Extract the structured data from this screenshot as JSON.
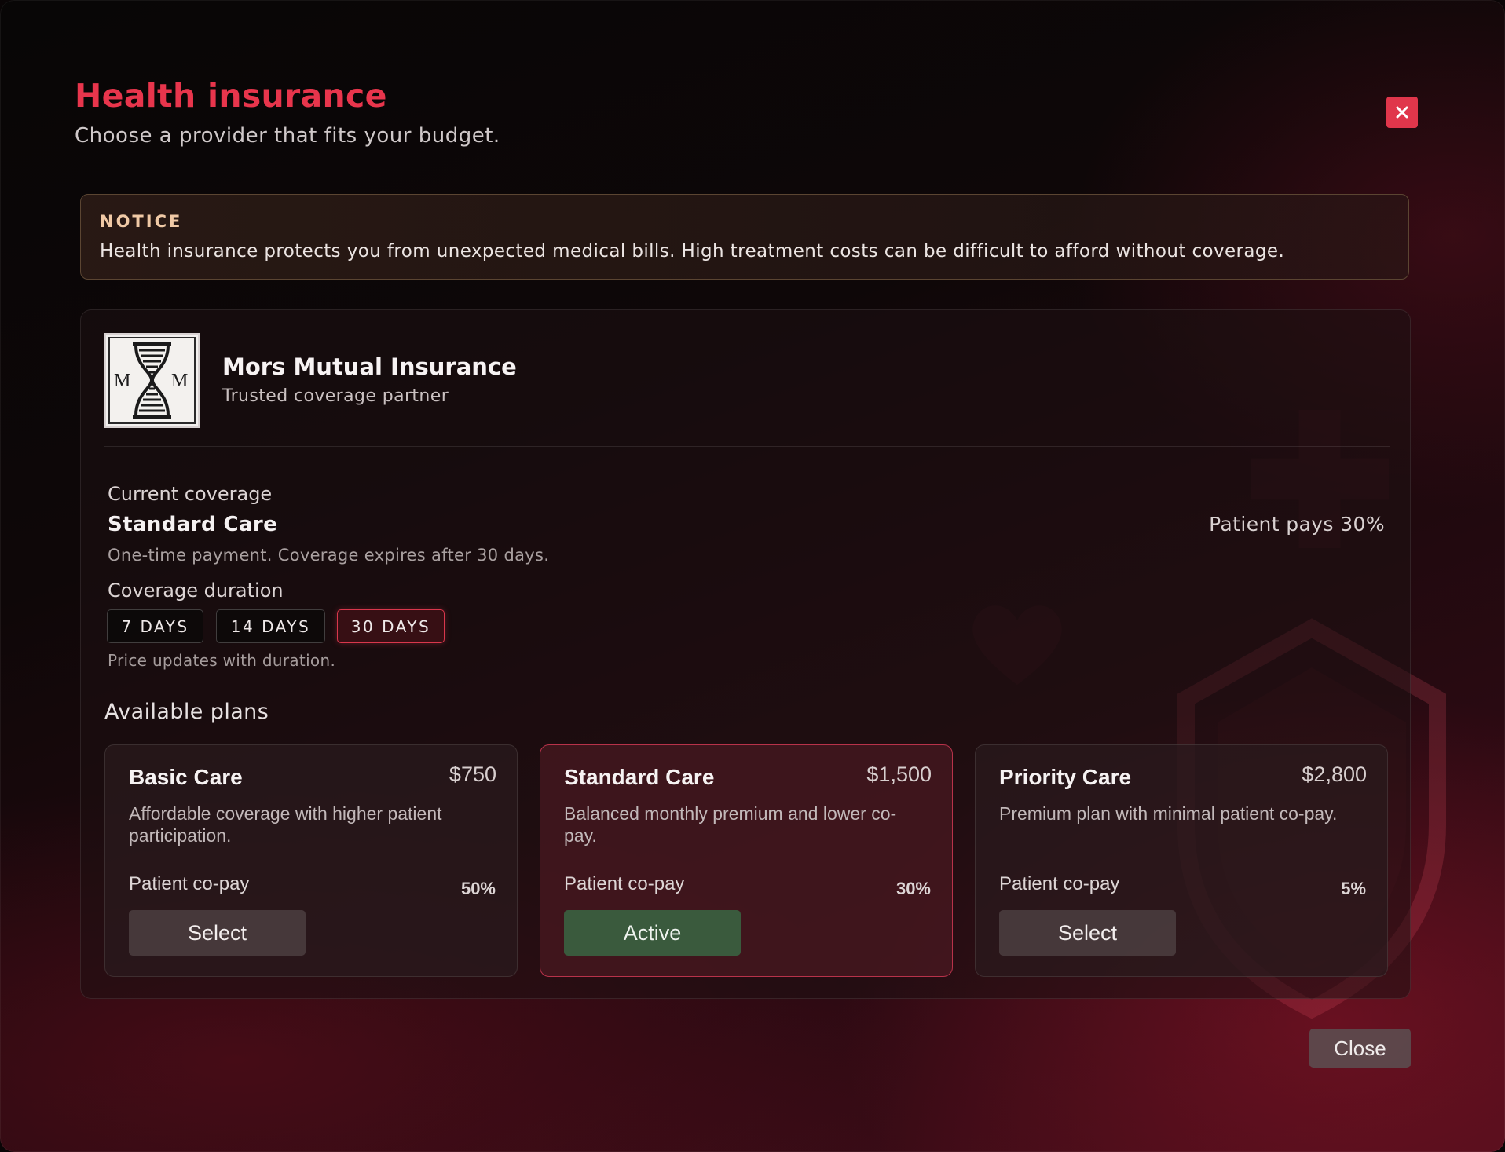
{
  "header": {
    "title": "Health insurance",
    "subtitle": "Choose a provider that fits your budget.",
    "close_x_label": "X"
  },
  "notice": {
    "label": "NOTICE",
    "text": "Health insurance protects you from unexpected medical bills. High treatment costs can be difficult to afford without coverage."
  },
  "provider": {
    "name": "Mors Mutual Insurance",
    "tagline": "Trusted coverage partner",
    "logo_letters": [
      "M",
      "M"
    ],
    "logo_icon": "hourglass-icon"
  },
  "current": {
    "label": "Current coverage",
    "plan": "Standard Care",
    "description": "One-time payment. Coverage expires after 30 days.",
    "patient_pays": "Patient pays 30%"
  },
  "duration": {
    "label": "Coverage duration",
    "options": [
      "7 DAYS",
      "14 DAYS",
      "30 DAYS"
    ],
    "selected": "30 DAYS",
    "hint": "Price updates with duration."
  },
  "plans": {
    "label": "Available plans",
    "items": [
      {
        "name": "Basic Care",
        "price": "$750",
        "description": "Affordable coverage with higher patient participation.",
        "copay_label": "Patient co-pay",
        "copay": "50%",
        "button": "Select"
      },
      {
        "name": "Standard Care",
        "price": "$1,500",
        "description": "Balanced monthly premium and lower co-pay.",
        "copay_label": "Patient co-pay",
        "copay": "30%",
        "button": "Active"
      },
      {
        "name": "Priority Care",
        "price": "$2,800",
        "description": "Premium plan with minimal patient co-pay.",
        "copay_label": "Patient co-pay",
        "copay": "5%",
        "button": "Select"
      }
    ]
  },
  "footer": {
    "close_label": "Close"
  },
  "colors": {
    "accent": "#e8354c",
    "active_button": "#3a5a3d",
    "notice_label": "#f0c9a6"
  }
}
